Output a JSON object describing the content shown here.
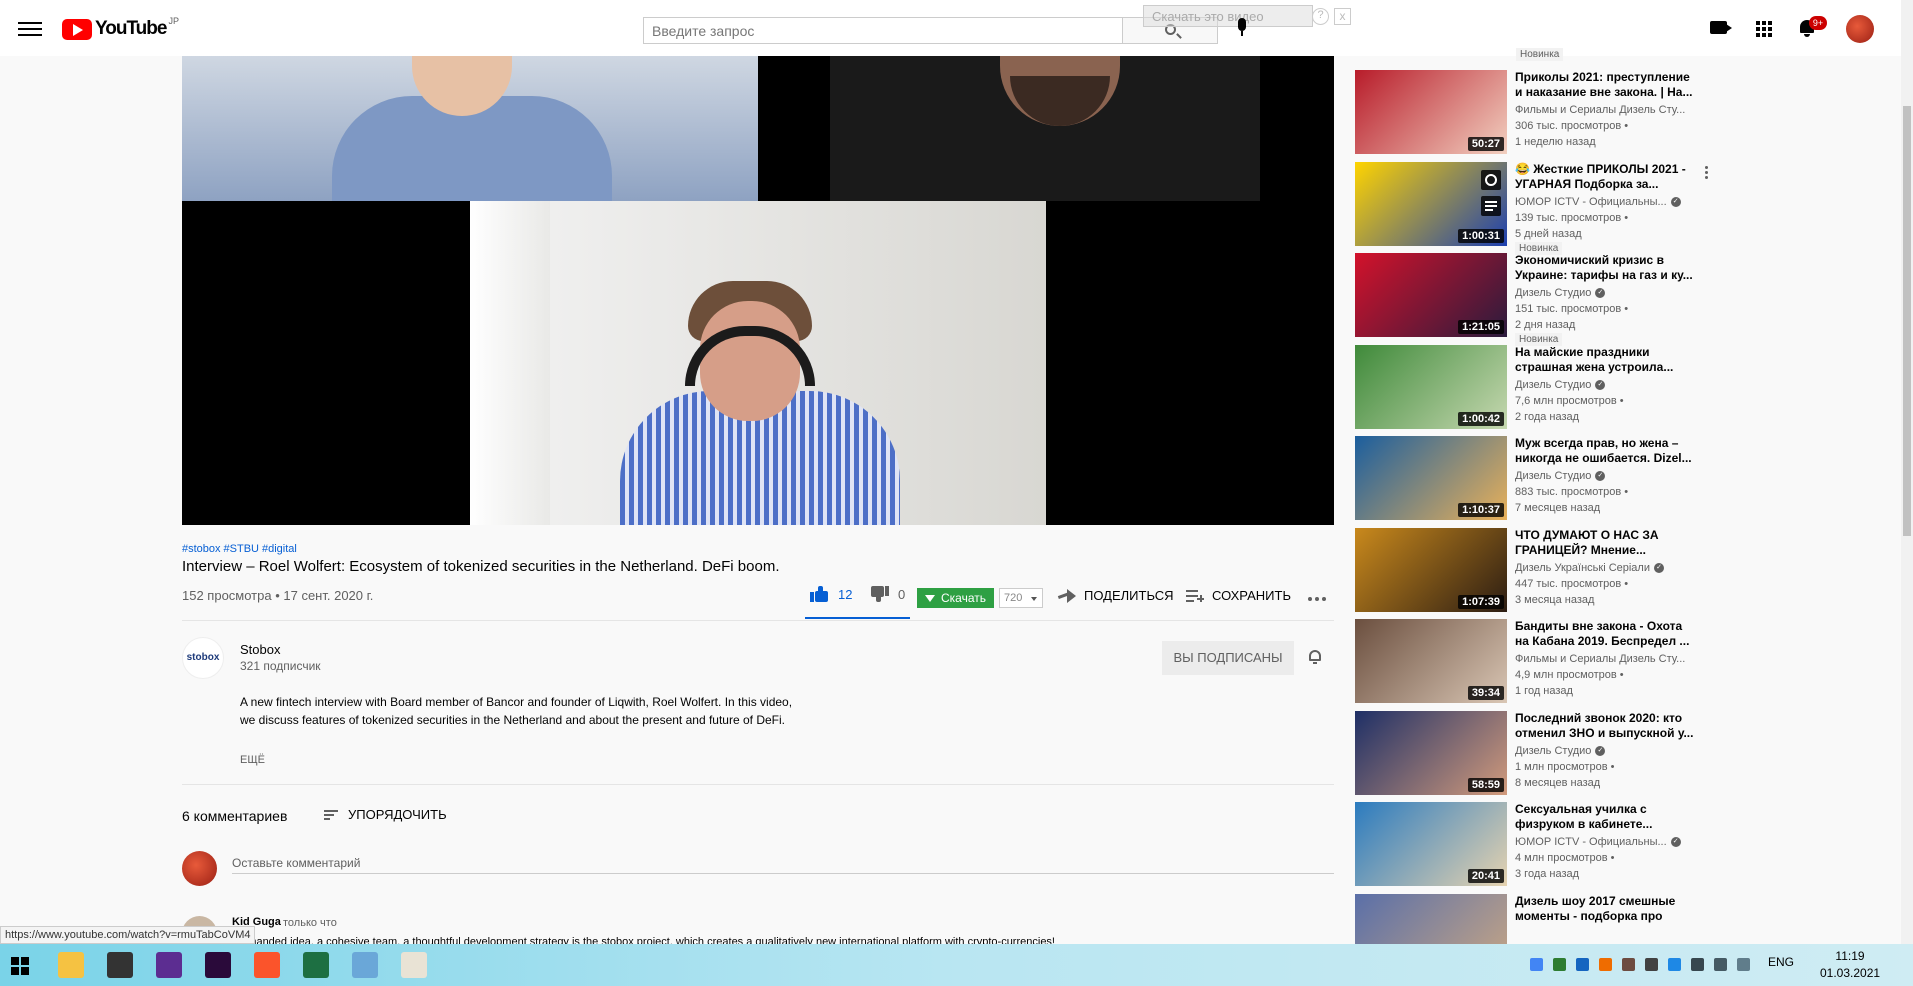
{
  "header": {
    "logo_text": "YouTube",
    "logo_country": "JP",
    "search_placeholder": "Введите запрос",
    "download_overlay": "Скачать это видео",
    "overlay_help": "?",
    "overlay_close": "x",
    "notifications_badge": "9+"
  },
  "video": {
    "hashtags": [
      "#stobox",
      "#STBU",
      "#digital"
    ],
    "title": "Interview – Roel Wolfert: Ecosystem of tokenized securities in the Netherland. DeFi boom.",
    "views_date": "152 просмотра • 17 сент. 2020 г.",
    "likes": "12",
    "like_fraction": 1.0,
    "dislikes": "0",
    "download_label": "Скачать",
    "download_quality": "720",
    "share_label": "ПОДЕЛИТЬСЯ",
    "save_label": "СОХРАНИТЬ"
  },
  "channel": {
    "avatar_text": "stobox",
    "name": "Stobox",
    "subscribers": "321 подписчик",
    "subscribed_label": "ВЫ ПОДПИСАНЫ"
  },
  "description": {
    "text": "A new fintech interview with Board member of Bancor and founder of  Liqwith, Roel Wolfert. In this video, we discuss features of tokenized securities in the Netherland and about the present and future of DeFi.",
    "more": "ЕЩЁ"
  },
  "comments": {
    "count_label": "6 комментариев",
    "sort_label": "УПОРЯДОЧИТЬ",
    "input_placeholder": "Оставьте комментарий",
    "first": {
      "author": "Kid Guga",
      "time": "только что",
      "text": "...emanded idea, a cohesive team, a thoughtful development strategy is the stobox project, which creates a qualitatively new international platform with crypto-currencies!"
    }
  },
  "status_url": "https://www.youtube.com/watch?v=rmuTabCoVM4",
  "sidebar": {
    "top_new_badge": "Новинка",
    "recommendations": [
      {
        "title": "Приколы 2021: преступление и наказание вне закона. | На...",
        "channel": "Фильмы и Сериалы Дизель Сту...",
        "views": "306 тыс. просмотров •",
        "age": "1 неделю назад",
        "duration": "50:27",
        "badge": "",
        "verified": false,
        "thumb_a": "#b81c2a",
        "thumb_b": "#f2d0c0"
      },
      {
        "title": "😂 Жесткие ПРИКОЛЫ 2021 - УГАРНАЯ Подборка за...",
        "channel": "ЮМОР ICTV - Официальны...",
        "views": "139 тыс. просмотров •",
        "age": "5 дней назад",
        "duration": "1:00:31",
        "badge": "Новинка",
        "verified": true,
        "thumb_a": "#ffd400",
        "thumb_b": "#1c3fb0"
      },
      {
        "title": "Экономичиский кризис в Украине: тарифы на газ и ку...",
        "channel": "Дизель Студио",
        "views": "151 тыс. просмотров •",
        "age": "2 дня назад",
        "duration": "1:21:05",
        "badge": "Новинка",
        "verified": true,
        "thumb_a": "#d3122b",
        "thumb_b": "#2a1b3d"
      },
      {
        "title": "На майские праздники страшная жена устроила...",
        "channel": "Дизель Студио",
        "views": "7,6 млн просмотров •",
        "age": "2 года назад",
        "duration": "1:00:42",
        "badge": "",
        "verified": true,
        "thumb_a": "#3f8a3a",
        "thumb_b": "#c6d8b0"
      },
      {
        "title": "Муж всегда прав, но жена – никогда не ошибается. Dizel...",
        "channel": "Дизель Студио",
        "views": "883 тыс. просмотров •",
        "age": "7 месяцев назад",
        "duration": "1:10:37",
        "badge": "",
        "verified": true,
        "thumb_a": "#1b5e9e",
        "thumb_b": "#e9b15a"
      },
      {
        "title": "ЧТО ДУМАЮТ О НАС ЗА ГРАНИЦЕЙ? Мнение...",
        "channel": "Дизель Українські Серіали",
        "views": "447 тыс. просмотров •",
        "age": "3 месяца назад",
        "duration": "1:07:39",
        "badge": "",
        "verified": true,
        "thumb_a": "#c9891c",
        "thumb_b": "#2c1d13"
      },
      {
        "title": "Бандиты вне закона - Охота на Кабана 2019. Беспредел ...",
        "channel": "Фильмы и Сериалы Дизель Сту...",
        "views": "4,9 млн просмотров •",
        "age": "1 год назад",
        "duration": "39:34",
        "badge": "",
        "verified": false,
        "thumb_a": "#6b4f3f",
        "thumb_b": "#d9c6b4"
      },
      {
        "title": "Последний звонок 2020: кто отменил ЗНО и выпускной у...",
        "channel": "Дизель Студио",
        "views": "1 млн просмотров •",
        "age": "8 месяцев назад",
        "duration": "58:59",
        "badge": "",
        "verified": true,
        "thumb_a": "#1e2f66",
        "thumb_b": "#d29b7c"
      },
      {
        "title": "Сексуальная училка с физруком в кабинете...",
        "channel": "ЮМОР ICTV - Официальны...",
        "views": "4 млн просмотров •",
        "age": "3 года назад",
        "duration": "20:41",
        "badge": "",
        "verified": true,
        "thumb_a": "#2b7bbf",
        "thumb_b": "#e6d3b0"
      },
      {
        "title": "Дизель шоу 2017 смешные моменты - подборка про spo...",
        "channel": "",
        "views": "",
        "age": "",
        "duration": "",
        "badge": "",
        "verified": false,
        "thumb_a": "#5a6fa8",
        "thumb_b": "#c9a784"
      }
    ]
  },
  "taskbar": {
    "lang": "ENG",
    "time": "11:19",
    "date": "01.03.2021",
    "apps": [
      {
        "name": "explorer",
        "color": "#f5c242"
      },
      {
        "name": "store",
        "color": "#333333"
      },
      {
        "name": "vs",
        "color": "#5c2d91"
      },
      {
        "name": "premiere",
        "color": "#2a0a3a"
      },
      {
        "name": "brave",
        "color": "#fb542b"
      },
      {
        "name": "excel",
        "color": "#1d6f42"
      },
      {
        "name": "notes",
        "color": "#6aa7d8"
      },
      {
        "name": "paint",
        "color": "#e9e3d5"
      }
    ]
  }
}
